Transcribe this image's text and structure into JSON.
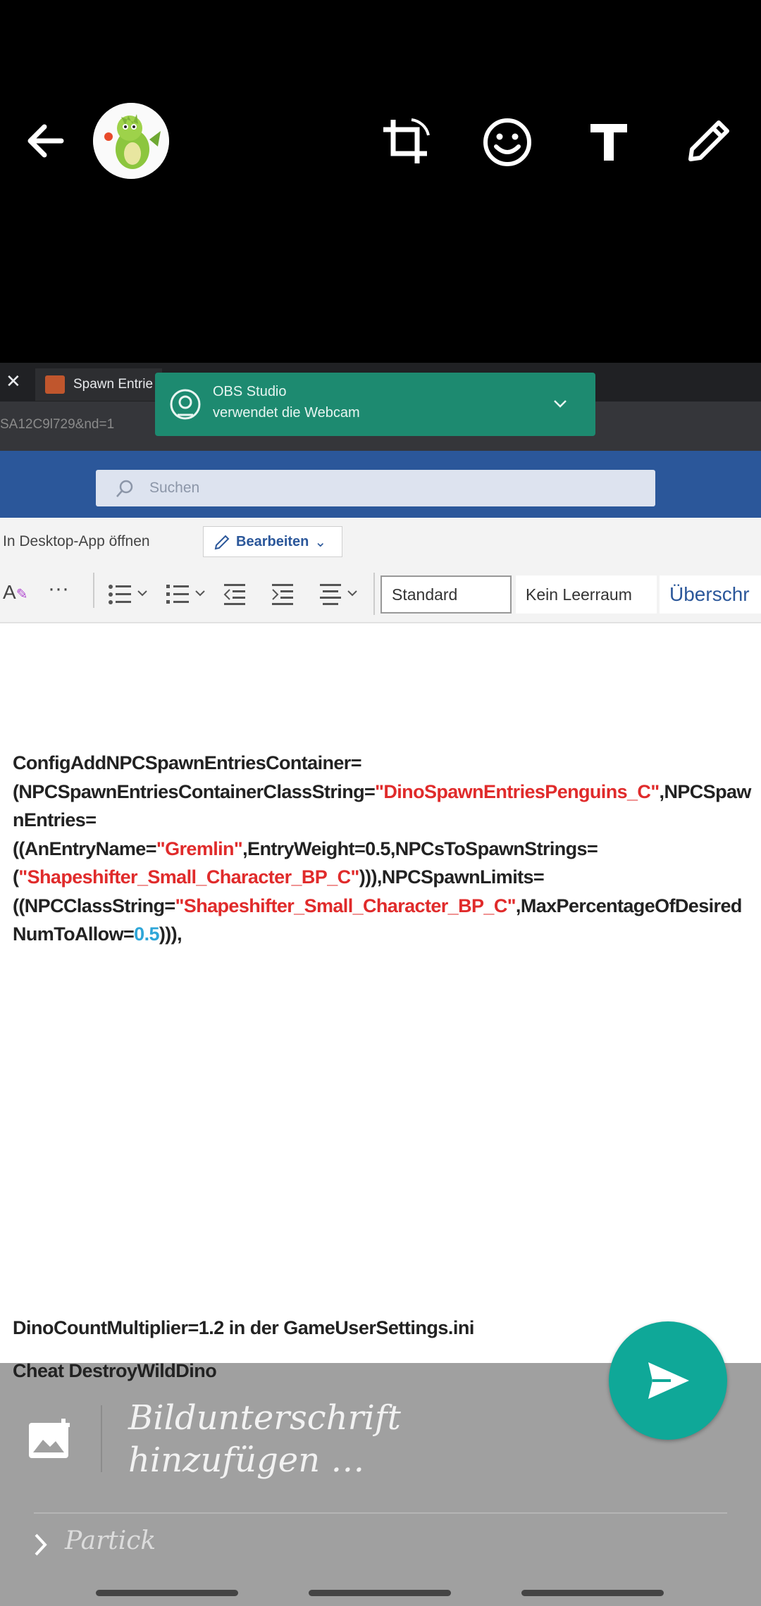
{
  "editor": {
    "caption_placeholder": "Bildunterschrift hinzufügen …",
    "recipient": "Partick"
  },
  "screenshot": {
    "tab_title": "Spawn Entrie",
    "url_fragment": "SA12C9l729&nd=1",
    "notification": {
      "title": "OBS Studio",
      "message": "verwendet die Webcam"
    },
    "search_placeholder": "Suchen",
    "open_in_desktop": "In Desktop-App öffnen",
    "edit_label": "Bearbeiten",
    "styles": [
      "Standard",
      "Kein Leerraum",
      "Überschr"
    ],
    "code": {
      "p1": "ConfigAddNPCSpawnEntriesContainer=",
      "p2": "(NPCSpawnEntriesContainerClassString=",
      "s1": "\"DinoSpawnEntriesPenguins_C\"",
      "p3": ",NPCSpawnEntries=",
      "p4": "((AnEntryName=",
      "s2": "\"Gremlin\"",
      "p5": ",EntryWeight=0.5,NPCsToSpawnStrings=",
      "p6": "(",
      "s3": "\"Shapeshifter_Small_Character_BP_C\"",
      "p7": "))),NPCSpawnLimits=",
      "p8": "((NPCClassString=",
      "s4": "\"Shapeshifter_Small_Character_BP_C\"",
      "p9": ",MaxPercentageOfDesiredNumToAllow=",
      "n1": "0.5",
      "p10": "))),"
    },
    "line_multiplier": "DinoCountMultiplier=1.2 in der GameUserSettings.ini",
    "line_cheat": "Cheat DestroyWildDino"
  },
  "colors": {
    "accent": "#0fa898",
    "word_blue": "#2b579a",
    "obs_green": "#1d8a70"
  }
}
